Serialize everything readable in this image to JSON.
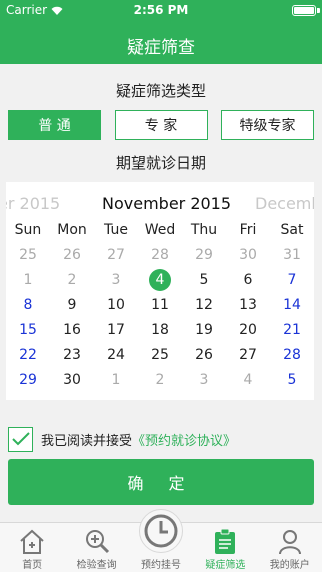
{
  "status_bar": {
    "carrier": "Carrier",
    "time": "2:56 PM"
  },
  "nav": {
    "title": "疑症筛查"
  },
  "type_section": {
    "title": "疑症筛选类型",
    "options": [
      {
        "label": "普 通",
        "active": true
      },
      {
        "label": "专 家",
        "active": false
      },
      {
        "label": "特级专家",
        "active": false
      }
    ]
  },
  "date_section": {
    "title": "期望就诊日期"
  },
  "calendar": {
    "prev_month": "er 2015",
    "current_month": "November 2015",
    "next_month": "Decemb",
    "weekdays": [
      "Sun",
      "Mon",
      "Tue",
      "Wed",
      "Thu",
      "Fri",
      "Sat"
    ],
    "weeks": [
      [
        "25",
        "26",
        "27",
        "28",
        "29",
        "30",
        "31"
      ],
      [
        "1",
        "2",
        "3",
        "4",
        "5",
        "6",
        "7"
      ],
      [
        "8",
        "9",
        "10",
        "11",
        "12",
        "13",
        "14"
      ],
      [
        "15",
        "16",
        "17",
        "18",
        "19",
        "20",
        "21"
      ],
      [
        "22",
        "23",
        "24",
        "25",
        "26",
        "27",
        "28"
      ],
      [
        "29",
        "30",
        "1",
        "2",
        "3",
        "4",
        "5"
      ]
    ],
    "selected_day": "4"
  },
  "agreement": {
    "text": "我已阅读并接受",
    "link": "《预约就诊协议》",
    "checked": true
  },
  "confirm_label": "确 定",
  "tabbar": {
    "items": [
      {
        "label": "首页",
        "icon": "home-icon"
      },
      {
        "label": "检验查询",
        "icon": "search-plus-icon"
      },
      {
        "label": "预约挂号",
        "icon": "clock-icon"
      },
      {
        "label": "疑症筛选",
        "icon": "clipboard-icon",
        "active": true
      },
      {
        "label": "我的账户",
        "icon": "user-icon"
      }
    ]
  },
  "colors": {
    "primary": "#2fb15a",
    "weekend": "#1a33d6",
    "muted": "#aaaaaa"
  }
}
